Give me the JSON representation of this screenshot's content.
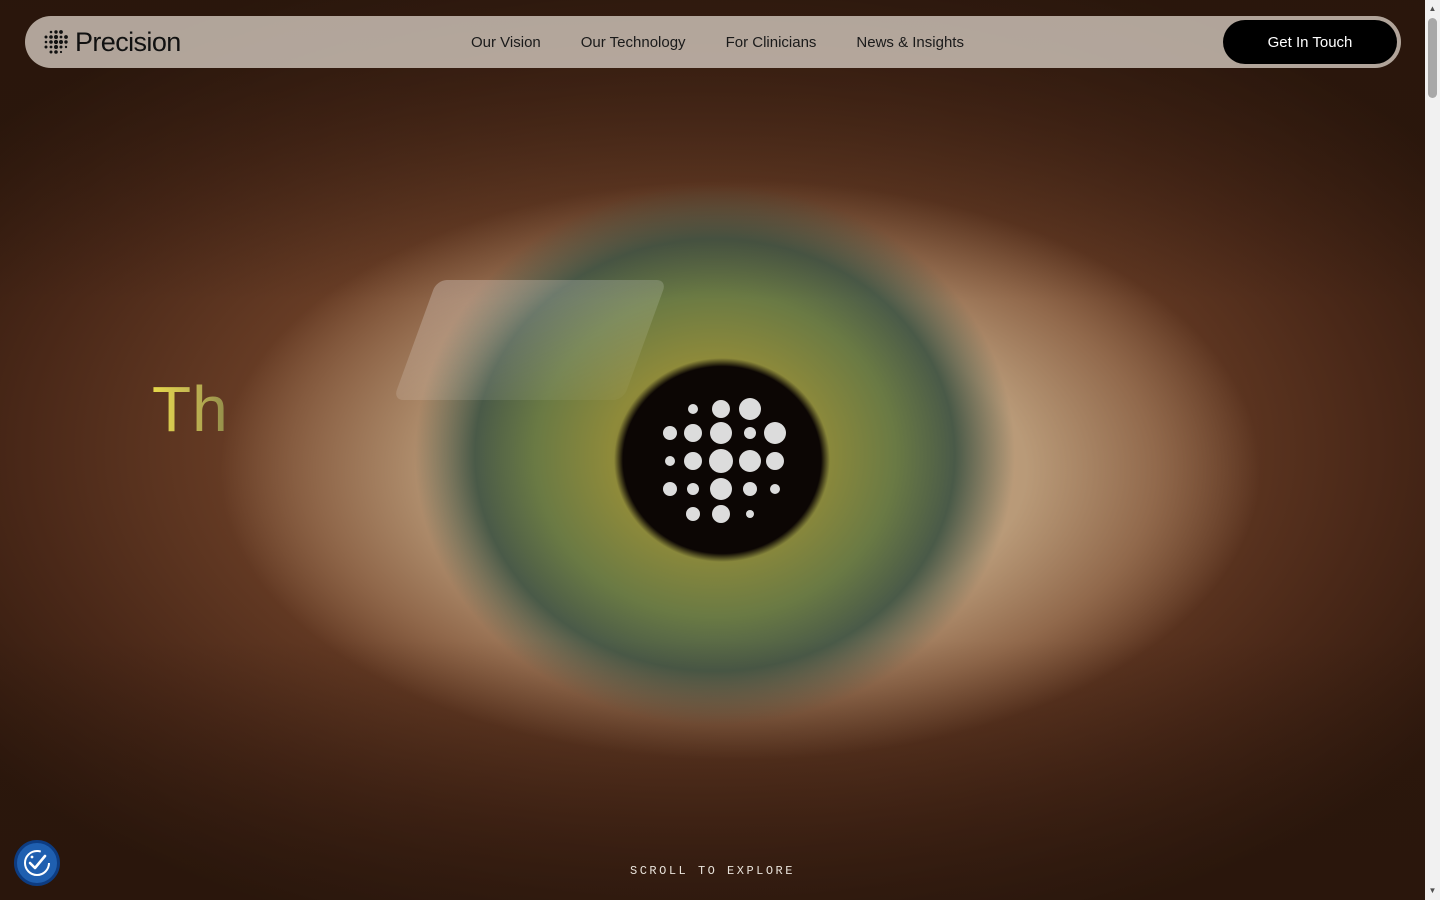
{
  "brand": {
    "name": "Precision",
    "logo_icon": "dot-grid-logo-icon"
  },
  "nav": {
    "links": [
      {
        "label": "Our Vision"
      },
      {
        "label": "Our Technology"
      },
      {
        "label": "For Clinicians"
      },
      {
        "label": "News & Insights"
      }
    ],
    "cta_label": "Get In Touch"
  },
  "hero": {
    "headline_partial": "Th",
    "background": "eye-closeup-image",
    "scroll_hint": "SCROLL TO EXPLORE"
  },
  "accessibility": {
    "icon": "accessibility-check-icon",
    "color": "#1f5fb0"
  },
  "colors": {
    "cta_bg": "#000000",
    "headline_accent": "#e6d94a",
    "navbar_bg": "#d7cdc3"
  }
}
